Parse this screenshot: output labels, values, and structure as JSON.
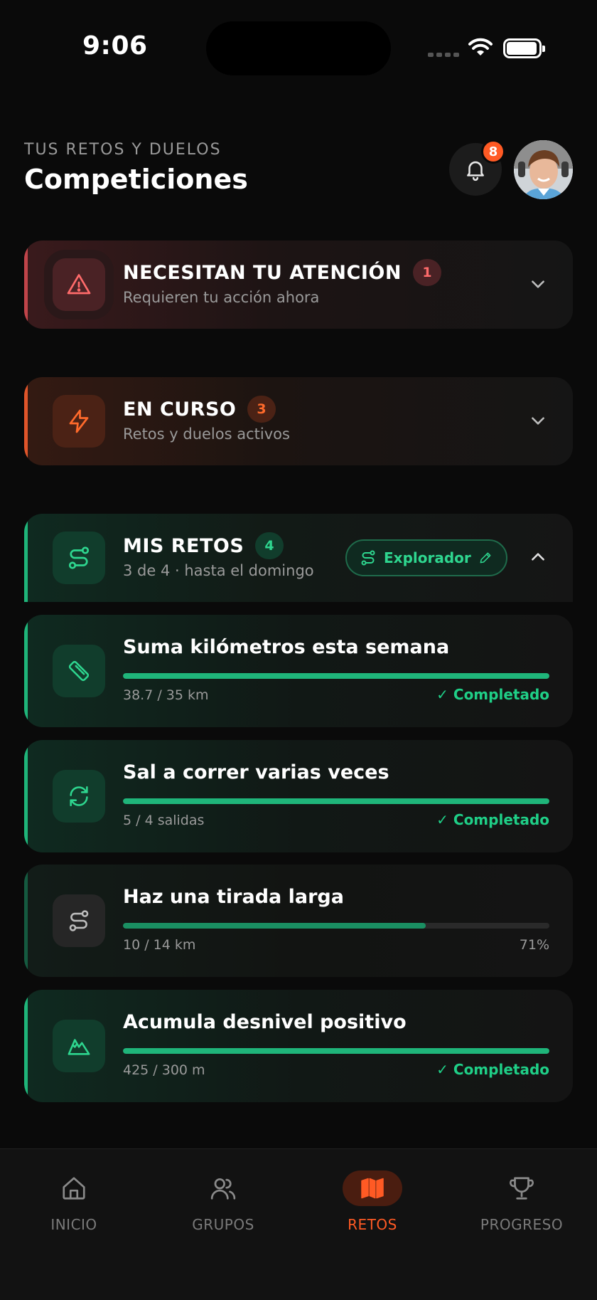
{
  "status_bar": {
    "time": "9:06"
  },
  "header": {
    "subtitle": "TUS RETOS Y DUELOS",
    "title": "Competiciones",
    "notifications_count": "8"
  },
  "sections": {
    "attention": {
      "title": "NECESITAN TU ATENCIÓN",
      "count": "1",
      "subtitle": "Requieren tu acción ahora"
    },
    "ongoing": {
      "title": "EN CURSO",
      "count": "3",
      "subtitle": "Retos y duelos activos"
    },
    "mine": {
      "title": "MIS RETOS",
      "count": "4",
      "subtitle": "3 de 4 · hasta el domingo",
      "explorer_label": "Explorador"
    }
  },
  "challenges": [
    {
      "title": "Suma kilómetros esta semana",
      "value": "38.7 / 35 km",
      "status": "✓ Completado",
      "progress": 1.0,
      "icon": "ruler-icon"
    },
    {
      "title": "Sal a correr varias veces",
      "value": "5 / 4 salidas",
      "status": "✓ Completado",
      "progress": 1.0,
      "icon": "repeat-icon"
    },
    {
      "title": "Haz una tirada larga",
      "value": "10 / 14 km",
      "status": "71%",
      "progress": 0.71,
      "icon": "route-icon"
    },
    {
      "title": "Acumula desnivel positivo",
      "value": "425 / 300 m",
      "status": "✓ Completado",
      "progress": 1.0,
      "icon": "mountain-icon"
    }
  ],
  "tabbar": {
    "items": [
      {
        "label": "INICIO",
        "icon": "home-icon"
      },
      {
        "label": "GRUPOS",
        "icon": "users-icon"
      },
      {
        "label": "RETOS",
        "icon": "map-icon",
        "active": true
      },
      {
        "label": "PROGRESO",
        "icon": "trophy-icon"
      }
    ]
  },
  "colors": {
    "accent_green": "#1fb57a",
    "accent_orange": "#ff5a24",
    "accent_red": "#c0444a"
  }
}
